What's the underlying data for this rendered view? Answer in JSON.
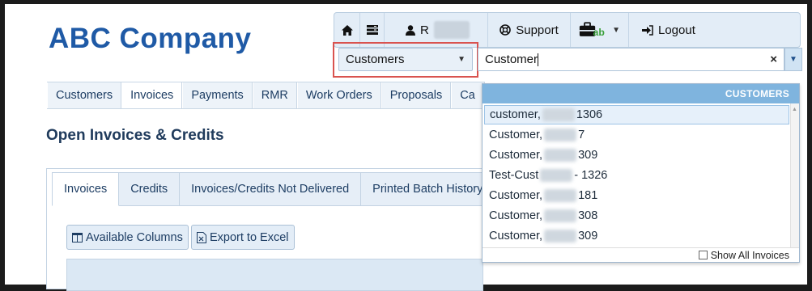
{
  "brand": {
    "logo_text": "ABC Company",
    "logo_color": "#1f5aa6"
  },
  "topbar": {
    "user_initial": "R",
    "support_label": "Support",
    "apps_label": "ab",
    "logout_label": "Logout",
    "icons": [
      "home-icon",
      "menu-icon",
      "user-icon",
      "lifebuoy-icon",
      "briefcase-icon",
      "logout-icon"
    ]
  },
  "search": {
    "type_select_value": "Customers",
    "query_value": "Customer",
    "clear_label": "×",
    "highlight_color": "#d9534f"
  },
  "nav": {
    "tabs": [
      "Customers",
      "Invoices",
      "Payments",
      "RMR",
      "Work Orders",
      "Proposals",
      "Ca"
    ],
    "active_index": 1
  },
  "page": {
    "title": "Open Invoices & Credits"
  },
  "subtabs": {
    "items": [
      "Invoices",
      "Credits",
      "Invoices/Credits Not Delivered",
      "Printed Batch History"
    ],
    "active_index": 0
  },
  "toolbar": {
    "available_columns_label": "Available Columns",
    "export_label": "Export to Excel"
  },
  "results": {
    "header": "CUSTOMERS",
    "items": [
      {
        "prefix": "customer,",
        "suffix": "1306"
      },
      {
        "prefix": "Customer,",
        "suffix": "7"
      },
      {
        "prefix": "Customer,",
        "suffix": "309"
      },
      {
        "prefix": "Test-Cust",
        "suffix": "- 1326"
      },
      {
        "prefix": "Customer,",
        "suffix": "181"
      },
      {
        "prefix": "Customer,",
        "suffix": "308"
      },
      {
        "prefix": "Customer,",
        "suffix": "309"
      }
    ],
    "show_all_label": "Show All Invoices"
  }
}
